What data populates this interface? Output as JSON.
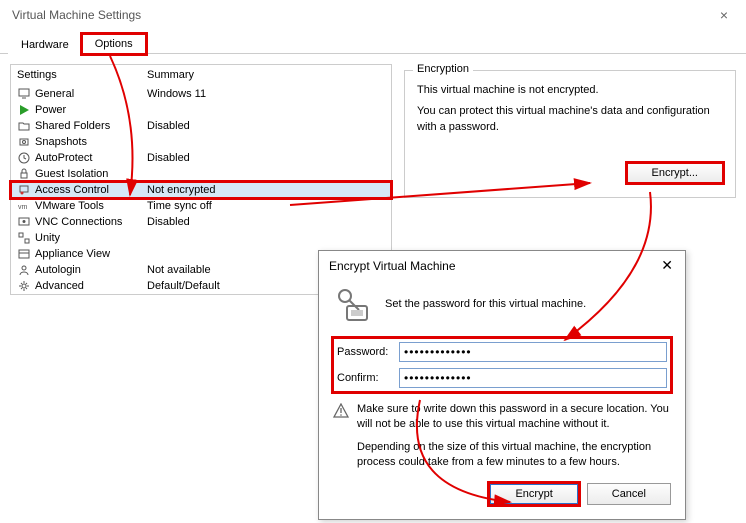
{
  "window": {
    "title": "Virtual Machine Settings"
  },
  "tabs": {
    "hardware": "Hardware",
    "options": "Options"
  },
  "listHeader": {
    "settings": "Settings",
    "summary": "Summary"
  },
  "settings": [
    {
      "label": "General",
      "summary": "Windows 11",
      "icon": "monitor"
    },
    {
      "label": "Power",
      "summary": "",
      "icon": "play"
    },
    {
      "label": "Shared Folders",
      "summary": "Disabled",
      "icon": "folder"
    },
    {
      "label": "Snapshots",
      "summary": "",
      "icon": "snapshot"
    },
    {
      "label": "AutoProtect",
      "summary": "Disabled",
      "icon": "clock"
    },
    {
      "label": "Guest Isolation",
      "summary": "",
      "icon": "lock"
    },
    {
      "label": "Access Control",
      "summary": "Not encrypted",
      "icon": "access",
      "selected": true
    },
    {
      "label": "VMware Tools",
      "summary": "Time sync off",
      "icon": "tools"
    },
    {
      "label": "VNC Connections",
      "summary": "Disabled",
      "icon": "vnc"
    },
    {
      "label": "Unity",
      "summary": "",
      "icon": "unity"
    },
    {
      "label": "Appliance View",
      "summary": "",
      "icon": "appliance"
    },
    {
      "label": "Autologin",
      "summary": "Not available",
      "icon": "autologin"
    },
    {
      "label": "Advanced",
      "summary": "Default/Default",
      "icon": "advanced"
    }
  ],
  "encryption": {
    "legend": "Encryption",
    "line1": "This virtual machine is not encrypted.",
    "line2": "You can protect this virtual machine's data and configuration with a password.",
    "button": "Encrypt..."
  },
  "dialog": {
    "title": "Encrypt Virtual Machine",
    "prompt": "Set the password for this virtual machine.",
    "passwordLabel": "Password:",
    "confirmLabel": "Confirm:",
    "passwordValue": "•••••••••••••",
    "confirmValue": "•••••••••••••",
    "warn": "Make sure to write down this password in a secure location. You will not be able to use this virtual machine without it.",
    "note": "Depending on the size of this virtual machine, the encryption process could take from a few minutes to a few hours.",
    "encryptBtn": "Encrypt",
    "cancelBtn": "Cancel"
  }
}
